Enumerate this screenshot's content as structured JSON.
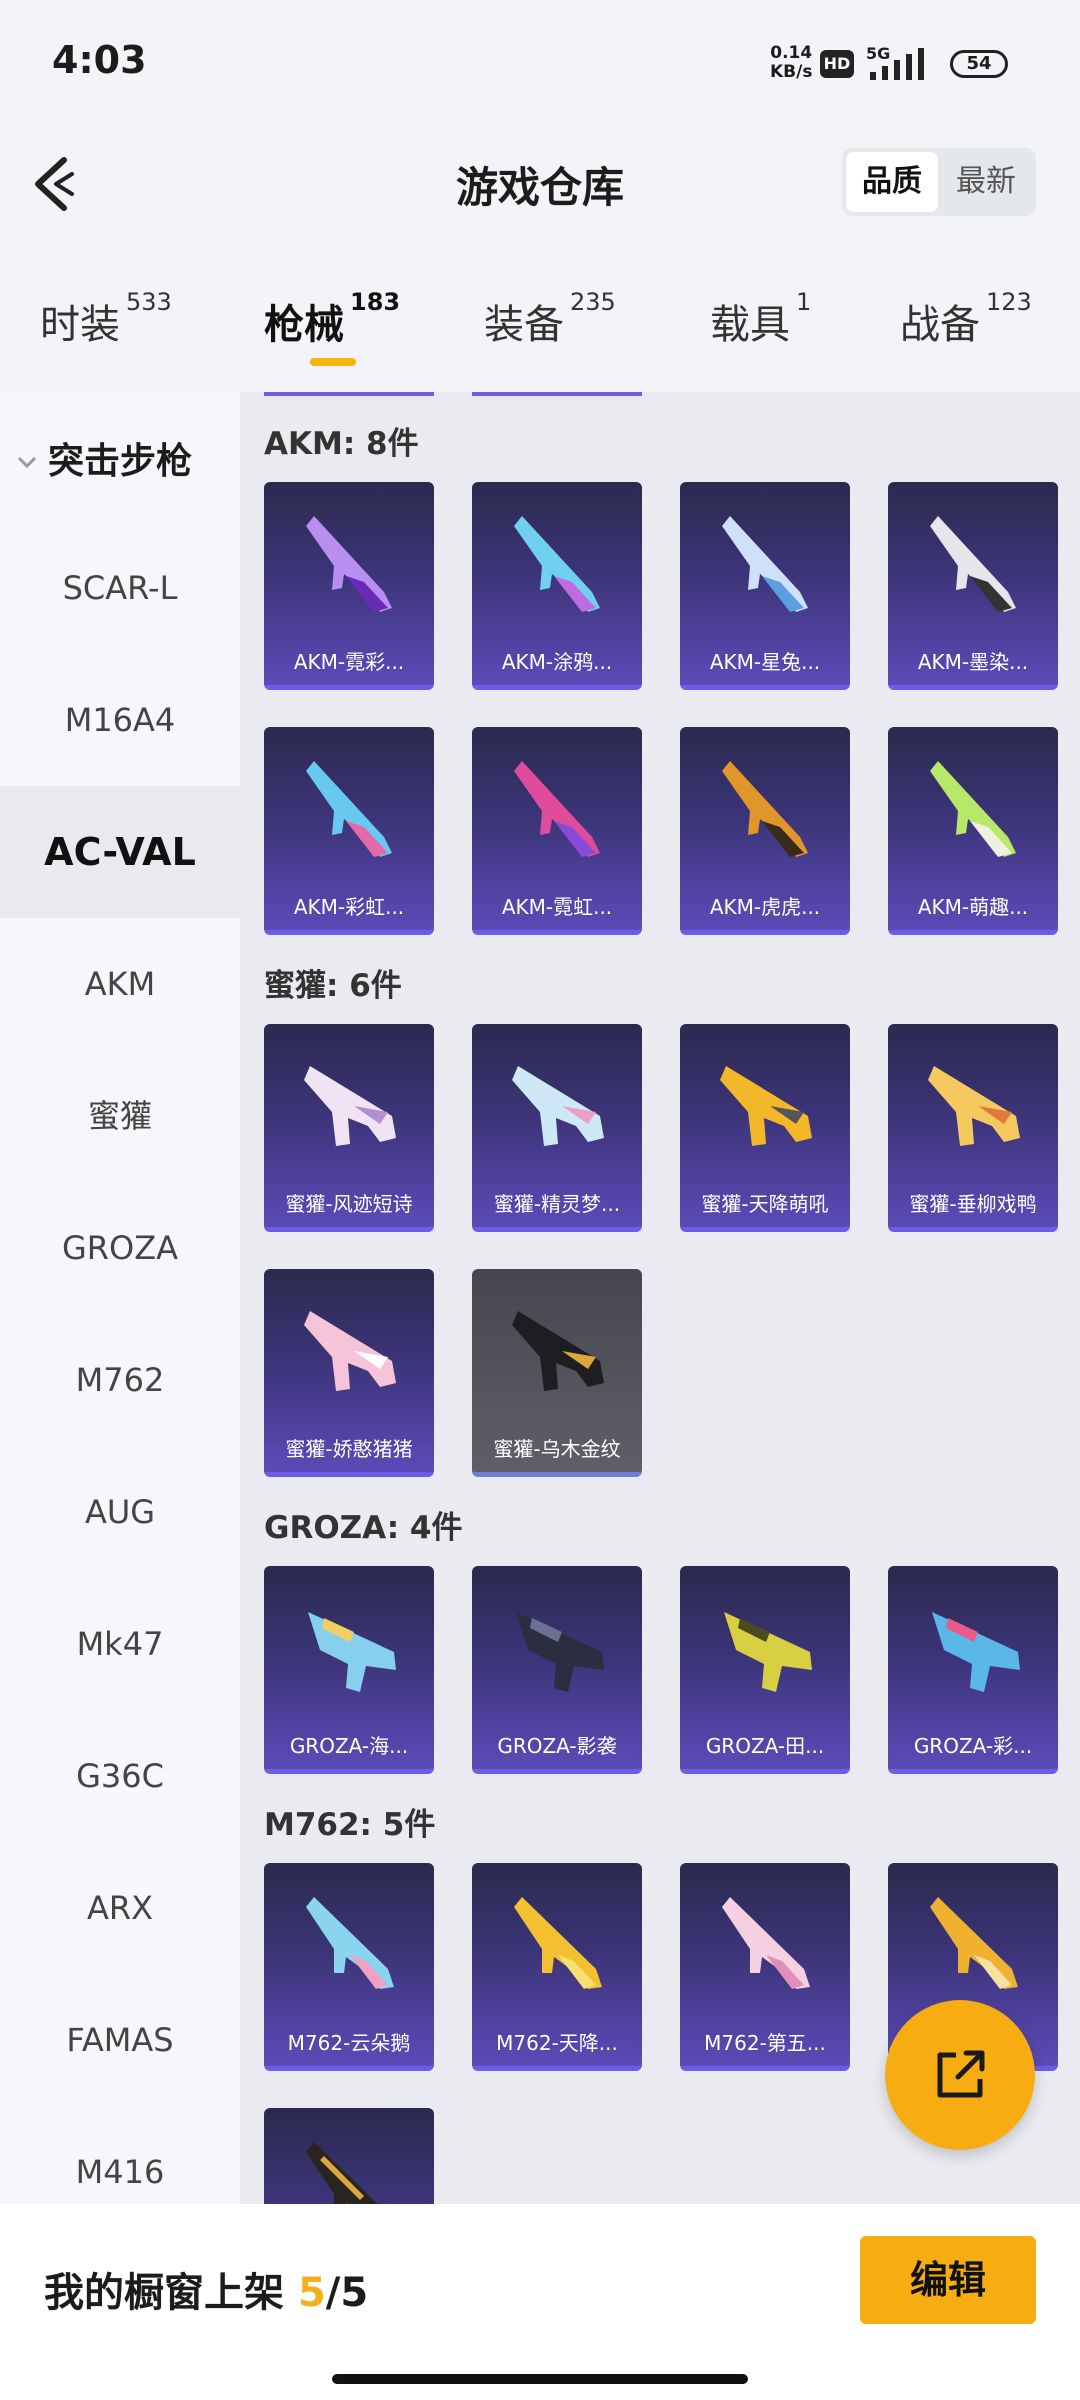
{
  "status_bar": {
    "time": "4:03",
    "net_speed": "0.14",
    "net_unit": "KB/s",
    "hd": "HD",
    "network": "5G",
    "battery": "54"
  },
  "header": {
    "title": "游戏仓库",
    "sort_options": [
      "品质",
      "最新"
    ],
    "active_sort": "品质"
  },
  "tabs": [
    {
      "label": "时装",
      "count": "533"
    },
    {
      "label": "枪械",
      "count": "183"
    },
    {
      "label": "装备",
      "count": "235"
    },
    {
      "label": "载具",
      "count": "1"
    },
    {
      "label": "战备",
      "count": "123"
    }
  ],
  "active_tab": "枪械",
  "sidebar": {
    "group": "突击步枪",
    "items": [
      "SCAR-L",
      "M16A4",
      "AC-VAL",
      "AKM",
      "蜜獾",
      "GROZA",
      "M762",
      "AUG",
      "Mk47",
      "G36C",
      "ARX",
      "FAMAS",
      "M416"
    ],
    "active_item": "AC-VAL"
  },
  "sections": [
    {
      "title": "AKM: 8件",
      "items": [
        "AKM-霓彩...",
        "AKM-涂鸦...",
        "AKM-星兔...",
        "AKM-墨染...",
        "AKM-彩虹...",
        "AKM-霓虹...",
        "AKM-虎虎...",
        "AKM-萌趣..."
      ]
    },
    {
      "title": "蜜獾: 6件",
      "items": [
        "蜜獾-风迹短诗",
        "蜜獾-精灵梦...",
        "蜜獾-天降萌吼",
        "蜜獾-垂柳戏鸭",
        "蜜獾-娇憨猪猪",
        "蜜獾-乌木金纹"
      ]
    },
    {
      "title": "GROZA: 4件",
      "items": [
        "GROZA-海...",
        "GROZA-影袭",
        "GROZA-田...",
        "GROZA-彩..."
      ]
    },
    {
      "title": "M762: 5件",
      "items": [
        "M762-云朵鹅",
        "M762-天降...",
        "M762-第五..."
      ]
    }
  ],
  "colors": {
    "accent": "#f7ad12",
    "card_purple": "#3c3478",
    "card_gray": "#55555e"
  },
  "fab_icon": "share-external-icon",
  "footer": {
    "label": "我的橱窗上架",
    "current": "5",
    "separator": "/",
    "total": "5",
    "edit": "编辑"
  }
}
